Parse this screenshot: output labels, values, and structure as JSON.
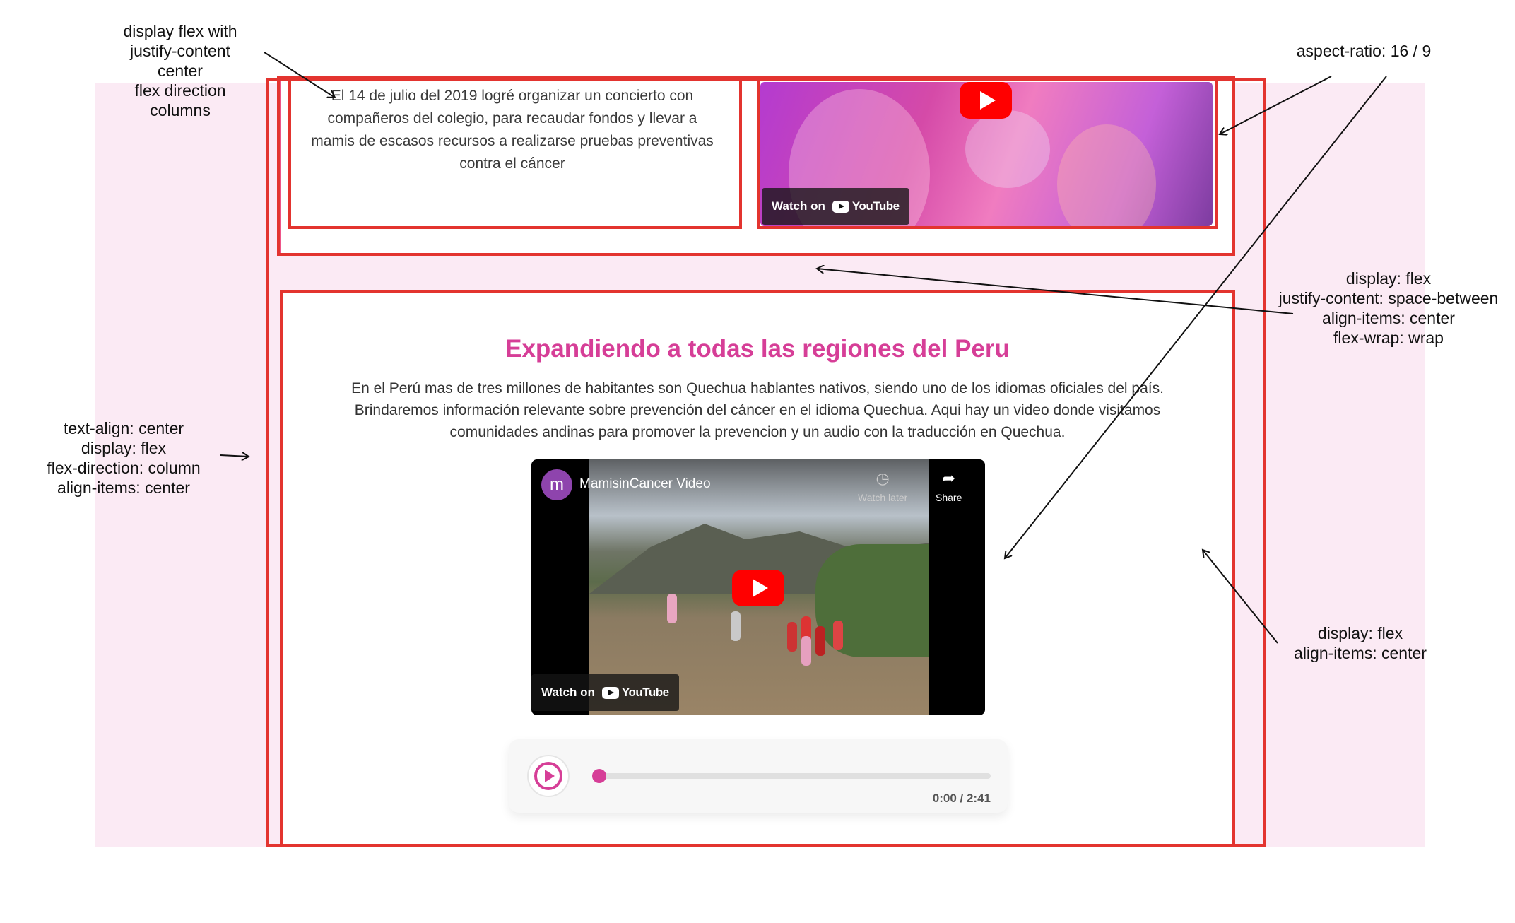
{
  "top_card": {
    "text": "El 14 de julio del 2019 logré organizar un concierto con compañeros del colegio, para recaudar fondos y llevar a mamis de escasos recursos a realizarse pruebas preventivas contra el cáncer",
    "video": {
      "watch_on": "Watch on",
      "youtube": "YouTube"
    }
  },
  "section": {
    "title": "Expandiendo a todas las regiones del Peru",
    "body": "En el Perú mas de tres millones de habitantes son Quechua hablantes nativos, siendo uno de los idiomas oficiales del país. Brindaremos información relevante sobre prevención del cáncer en el idioma Quechua. Aqui hay un video donde visitamos comunidades andinas para promover la prevencion y un audio con la traducción en Quechua.",
    "video": {
      "channel_initial": "m",
      "title": "MamisinCancer Video",
      "watch_later": "Watch later",
      "share": "Share",
      "watch_on": "Watch on",
      "youtube": "YouTube"
    },
    "audio": {
      "time": "0:00 / 2:41",
      "progress": 0
    }
  },
  "annotations": {
    "flex_column": "display flex with\njustify-content\ncenter\nflex direction\ncolumns",
    "aspect": "aspect-ratio: 16 / 9",
    "space_between": "display: flex\njustify-content: space-between\nalign-items: center\nflex-wrap: wrap",
    "text_center": "text-align: center\ndisplay: flex\nflex-direction: column\nalign-items: center",
    "align_center": "display: flex\nalign-items: center"
  },
  "colors": {
    "accent": "#d63e97",
    "outline": "#e3342f",
    "background": "#fbeaf4"
  }
}
